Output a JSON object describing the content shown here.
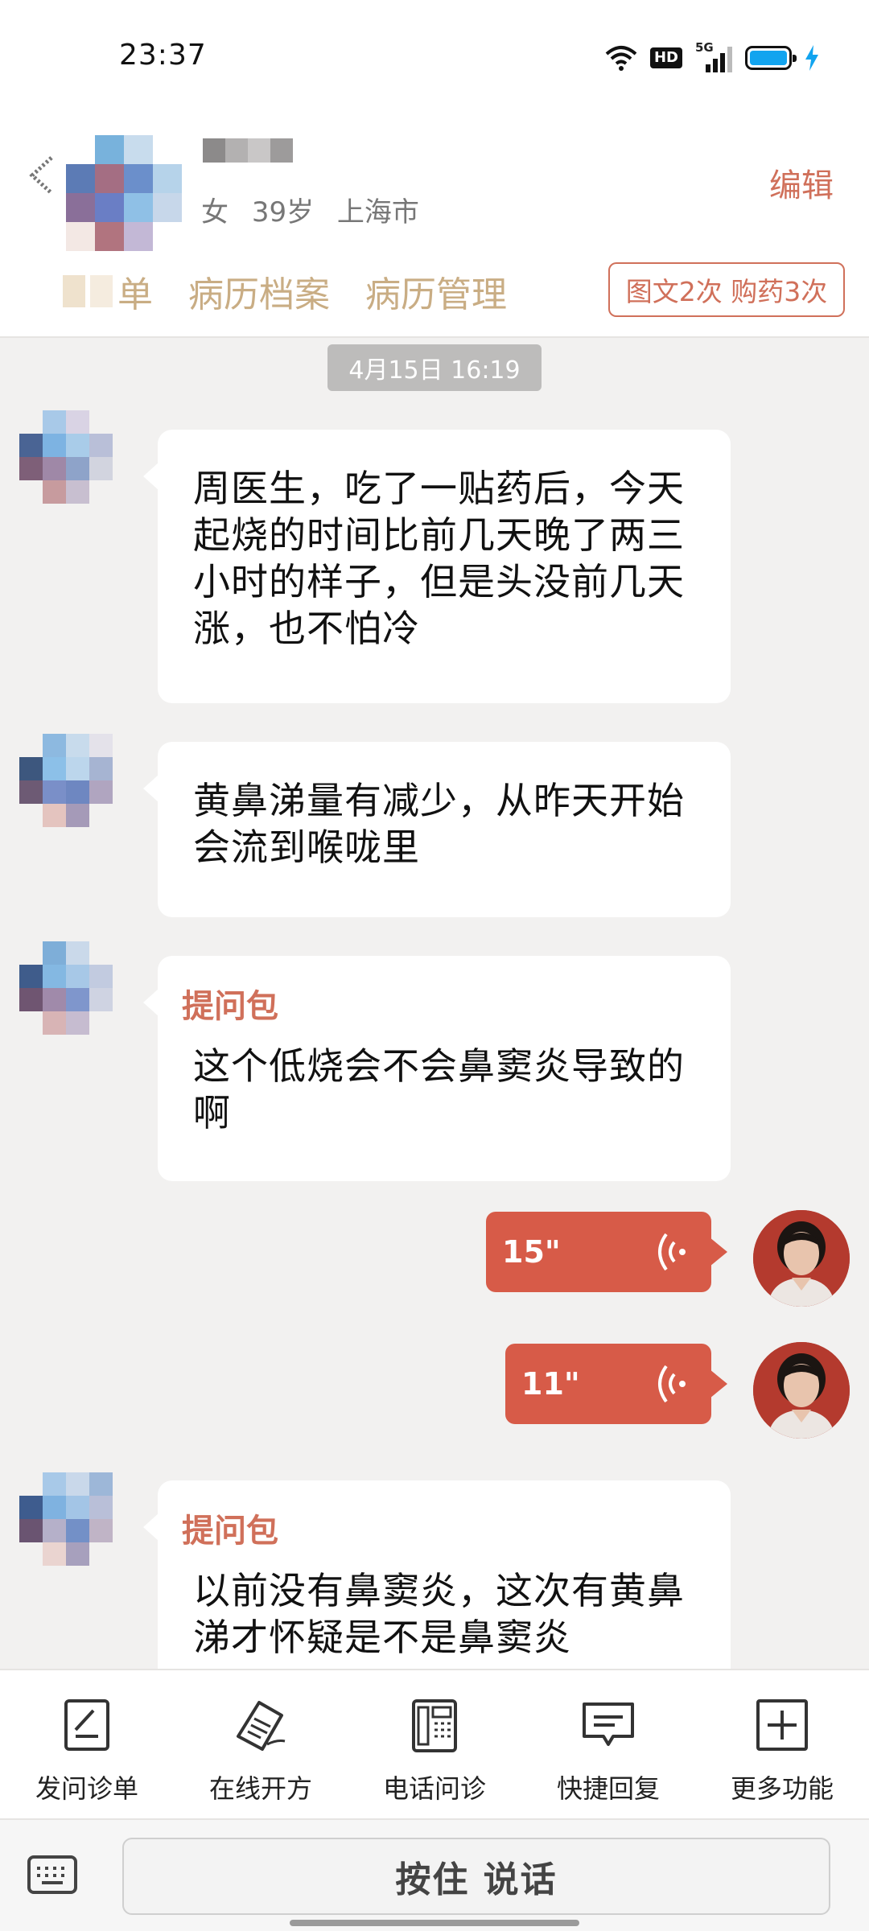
{
  "status_bar": {
    "time": "23:37",
    "hd": "HD",
    "network": "5G"
  },
  "header": {
    "patient_gender": "女",
    "patient_age": "39岁",
    "patient_city": "上海市",
    "edit_label": "编辑",
    "tabs": [
      {
        "label": "单"
      },
      {
        "label": "病历档案"
      },
      {
        "label": "病历管理"
      }
    ],
    "stats_badge": "图文2次 购药3次"
  },
  "chat": {
    "timestamp": "4月15日 16:19",
    "messages": [
      {
        "text": "周医生，吃了一贴药后，今天起烧的时间比前几天晚了两三小时的样子，但是头没前几天涨，也不怕冷"
      },
      {
        "text": "黄鼻涕量有减少，从昨天开始会流到喉咙里"
      },
      {
        "tag": "提问包",
        "text": "这个低烧会不会鼻窦炎导致的啊"
      },
      {
        "voice_duration": "15\""
      },
      {
        "voice_duration": "11\""
      },
      {
        "tag": "提问包",
        "text": "以前没有鼻窦炎，这次有黄鼻涕才怀疑是不是鼻窦炎"
      }
    ]
  },
  "toolbar": {
    "items": [
      {
        "label": "发问诊单",
        "icon": "form-icon"
      },
      {
        "label": "在线开方",
        "icon": "prescription-icon"
      },
      {
        "label": "电话问诊",
        "icon": "phone-icon"
      },
      {
        "label": "快捷回复",
        "icon": "quick-reply-icon"
      },
      {
        "label": "更多功能",
        "icon": "plus-icon"
      }
    ]
  },
  "input": {
    "talk_label": "按住 说话"
  },
  "colors": {
    "accent": "#d0705a",
    "voice_bubble": "#d75b48",
    "tab_text": "#c9ad84"
  }
}
